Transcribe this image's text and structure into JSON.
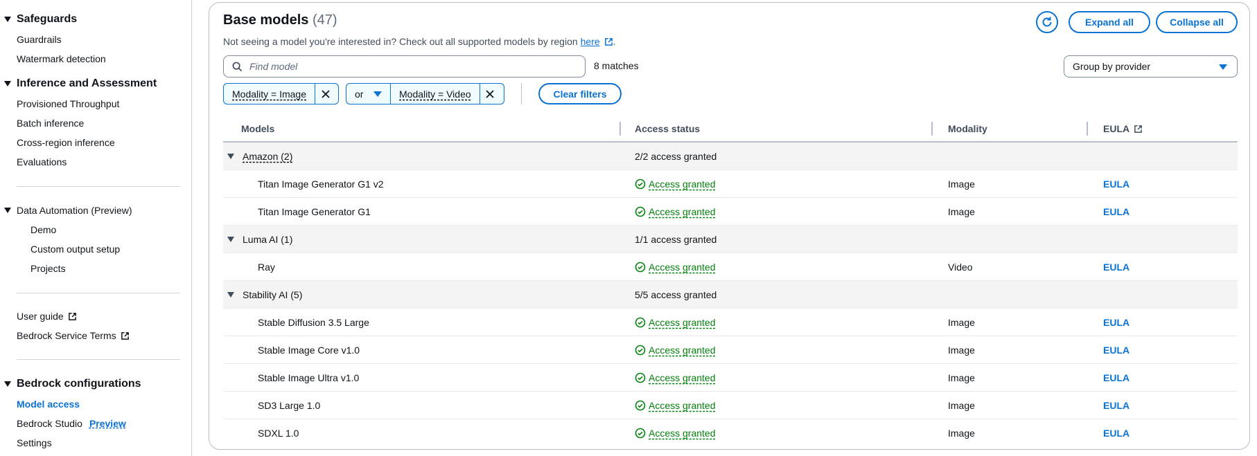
{
  "sidebar": {
    "safeguards": {
      "heading": "Safeguards",
      "items": [
        "Guardrails",
        "Watermark detection"
      ]
    },
    "inference": {
      "heading": "Inference and Assessment",
      "items": [
        "Provisioned Throughput",
        "Batch inference",
        "Cross-region inference",
        "Evaluations"
      ]
    },
    "data_automation": {
      "heading": "Data Automation (Preview)",
      "items": [
        "Demo",
        "Custom output setup",
        "Projects"
      ]
    },
    "links": {
      "user_guide": "User guide",
      "service_terms": "Bedrock Service Terms"
    },
    "configurations": {
      "heading": "Bedrock configurations",
      "model_access": "Model access",
      "studio": "Bedrock Studio",
      "studio_badge": "Preview",
      "settings": "Settings"
    }
  },
  "header": {
    "title": "Base models",
    "count": "(47)",
    "subtitle": "Not seeing a model you're interested in? Check out all supported models by region",
    "subtitle_link": "here",
    "subtitle_end": ".",
    "expand_all": "Expand all",
    "collapse_all": "Collapse all"
  },
  "search": {
    "placeholder": "Find model",
    "matches": "8 matches"
  },
  "group_by": {
    "selected": "Group by provider"
  },
  "filters": {
    "token1": "Modality = Image",
    "operator": "or",
    "token2": "Modality = Video",
    "clear": "Clear filters"
  },
  "table": {
    "headers": {
      "models": "Models",
      "access": "Access status",
      "modality": "Modality",
      "eula": "EULA"
    },
    "groups": [
      {
        "provider": "Amazon (2)",
        "summary": "2/2 access granted"
      },
      {
        "provider": "Luma AI (1)",
        "summary": "1/1 access granted"
      },
      {
        "provider": "Stability AI (5)",
        "summary": "5/5 access granted"
      }
    ],
    "rows": [
      {
        "model": "Titan Image Generator G1 v2",
        "status": "Access granted",
        "modality": "Image",
        "eula": "EULA"
      },
      {
        "model": "Titan Image Generator G1",
        "status": "Access granted",
        "modality": "Image",
        "eula": "EULA"
      },
      {
        "model": "Ray",
        "status": "Access granted",
        "modality": "Video",
        "eula": "EULA"
      },
      {
        "model": "Stable Diffusion 3.5 Large",
        "status": "Access granted",
        "modality": "Image",
        "eula": "EULA"
      },
      {
        "model": "Stable Image Core v1.0",
        "status": "Access granted",
        "modality": "Image",
        "eula": "EULA"
      },
      {
        "model": "Stable Image Ultra v1.0",
        "status": "Access granted",
        "modality": "Image",
        "eula": "EULA"
      },
      {
        "model": "SD3 Large 1.0",
        "status": "Access granted",
        "modality": "Image",
        "eula": "EULA"
      },
      {
        "model": "SDXL 1.0",
        "status": "Access granted",
        "modality": "Image",
        "eula": "EULA"
      }
    ]
  },
  "colors": {
    "accent": "#0972d3",
    "success": "#037f0c"
  }
}
